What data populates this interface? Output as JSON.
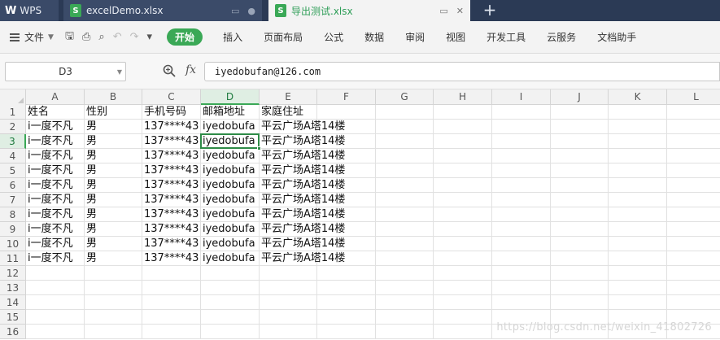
{
  "tabs": {
    "app_label": "WPS",
    "doc1": "excelDemo.xlsx",
    "doc2": "导出测试.xlsx",
    "new_tab": "+"
  },
  "menu": {
    "file": "文件",
    "home": "开始",
    "items": [
      "插入",
      "页面布局",
      "公式",
      "数据",
      "审阅",
      "视图",
      "开发工具",
      "云服务",
      "文档助手"
    ]
  },
  "formula": {
    "cell_ref": "D3",
    "fx": "fx",
    "value": "iyedobufan@126.com"
  },
  "sheet": {
    "columns": [
      "A",
      "B",
      "C",
      "D",
      "E",
      "F",
      "G",
      "H",
      "I",
      "J",
      "K",
      "L"
    ],
    "active_column": "D",
    "active_row": 3,
    "row_count": 16,
    "rows": [
      [
        "姓名",
        "性别",
        "手机号码",
        "邮箱地址",
        "家庭住址"
      ],
      [
        "i一度不凡",
        "男",
        "137****43",
        "iyedobufa",
        "平云广场A塔14楼"
      ],
      [
        "i一度不凡",
        "男",
        "137****43",
        "iyedobufa",
        "平云广场A塔14楼"
      ],
      [
        "i一度不凡",
        "男",
        "137****43",
        "iyedobufa",
        "平云广场A塔14楼"
      ],
      [
        "i一度不凡",
        "男",
        "137****43",
        "iyedobufa",
        "平云广场A塔14楼"
      ],
      [
        "i一度不凡",
        "男",
        "137****43",
        "iyedobufa",
        "平云广场A塔14楼"
      ],
      [
        "i一度不凡",
        "男",
        "137****43",
        "iyedobufa",
        "平云广场A塔14楼"
      ],
      [
        "i一度不凡",
        "男",
        "137****43",
        "iyedobufa",
        "平云广场A塔14楼"
      ],
      [
        "i一度不凡",
        "男",
        "137****43",
        "iyedobufa",
        "平云广场A塔14楼"
      ],
      [
        "i一度不凡",
        "男",
        "137****43",
        "iyedobufa",
        "平云广场A塔14楼"
      ],
      [
        "i一度不凡",
        "男",
        "137****43",
        "iyedobufa",
        "平云广场A塔14楼"
      ]
    ]
  },
  "watermark": "https://blog.csdn.net/weixin_41802726",
  "colors": {
    "accent": "#3aa856",
    "tabbar": "#2b3a55",
    "selection": "#2e8b47"
  }
}
